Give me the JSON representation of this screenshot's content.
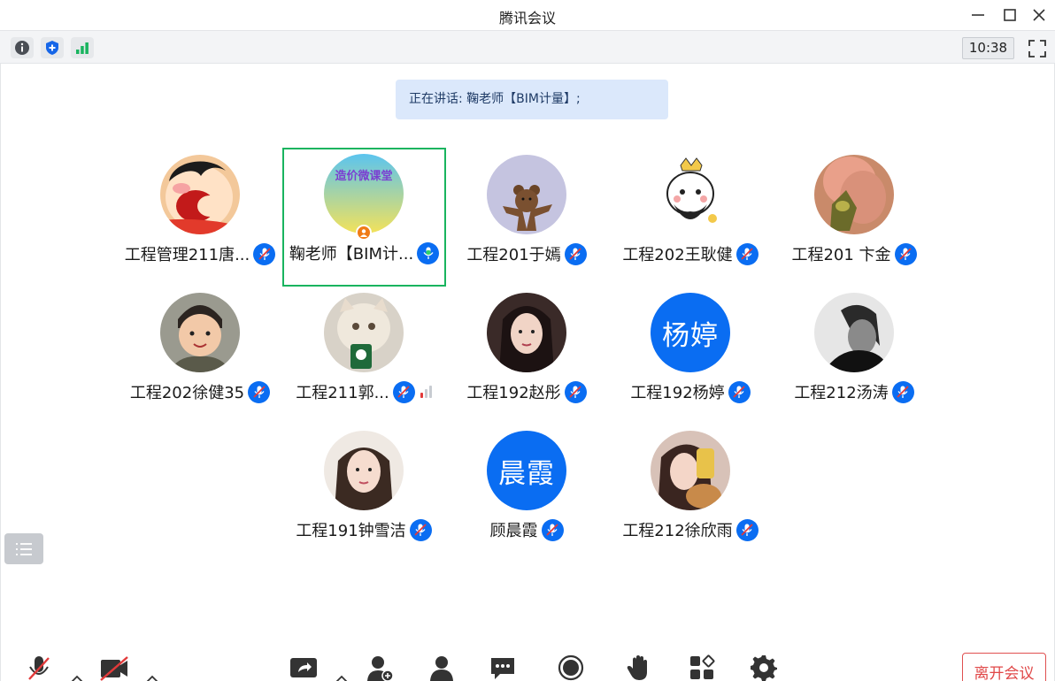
{
  "window": {
    "title": "腾讯会议"
  },
  "toolbar": {
    "time": "10:38"
  },
  "banner": {
    "text": "正在讲话: 鞠老师【BIM计量】;"
  },
  "participants": [
    {
      "name": "工程管理211唐...",
      "mic": "muted"
    },
    {
      "name": "鞠老师【BIM计...",
      "mic": "speaking",
      "host": true,
      "avatar_text": "造价微课堂"
    },
    {
      "name": "工程201于嫣",
      "mic": "muted"
    },
    {
      "name": "工程202王耿健",
      "mic": "muted"
    },
    {
      "name": "工程201 卞金",
      "mic": "muted"
    },
    {
      "name": "工程202徐健35",
      "mic": "muted"
    },
    {
      "name": "工程211郭...",
      "mic": "muted",
      "network": "weak"
    },
    {
      "name": "工程192赵彤",
      "mic": "muted"
    },
    {
      "name": "工程192杨婷",
      "mic": "muted",
      "initials": "杨婷"
    },
    {
      "name": "工程212汤涛",
      "mic": "muted"
    },
    {
      "name": "工程191钟雪洁",
      "mic": "muted"
    },
    {
      "name": "顾晨霞",
      "mic": "muted",
      "initials": "晨霞"
    },
    {
      "name": "工程212徐欣雨",
      "mic": "muted"
    }
  ],
  "bottom": {
    "leave_label": "离开会议"
  },
  "colors": {
    "accent": "#0a6df2",
    "speaking_border": "#19b45f",
    "leave": "#e04848",
    "banner_bg": "#dbe8fb"
  }
}
